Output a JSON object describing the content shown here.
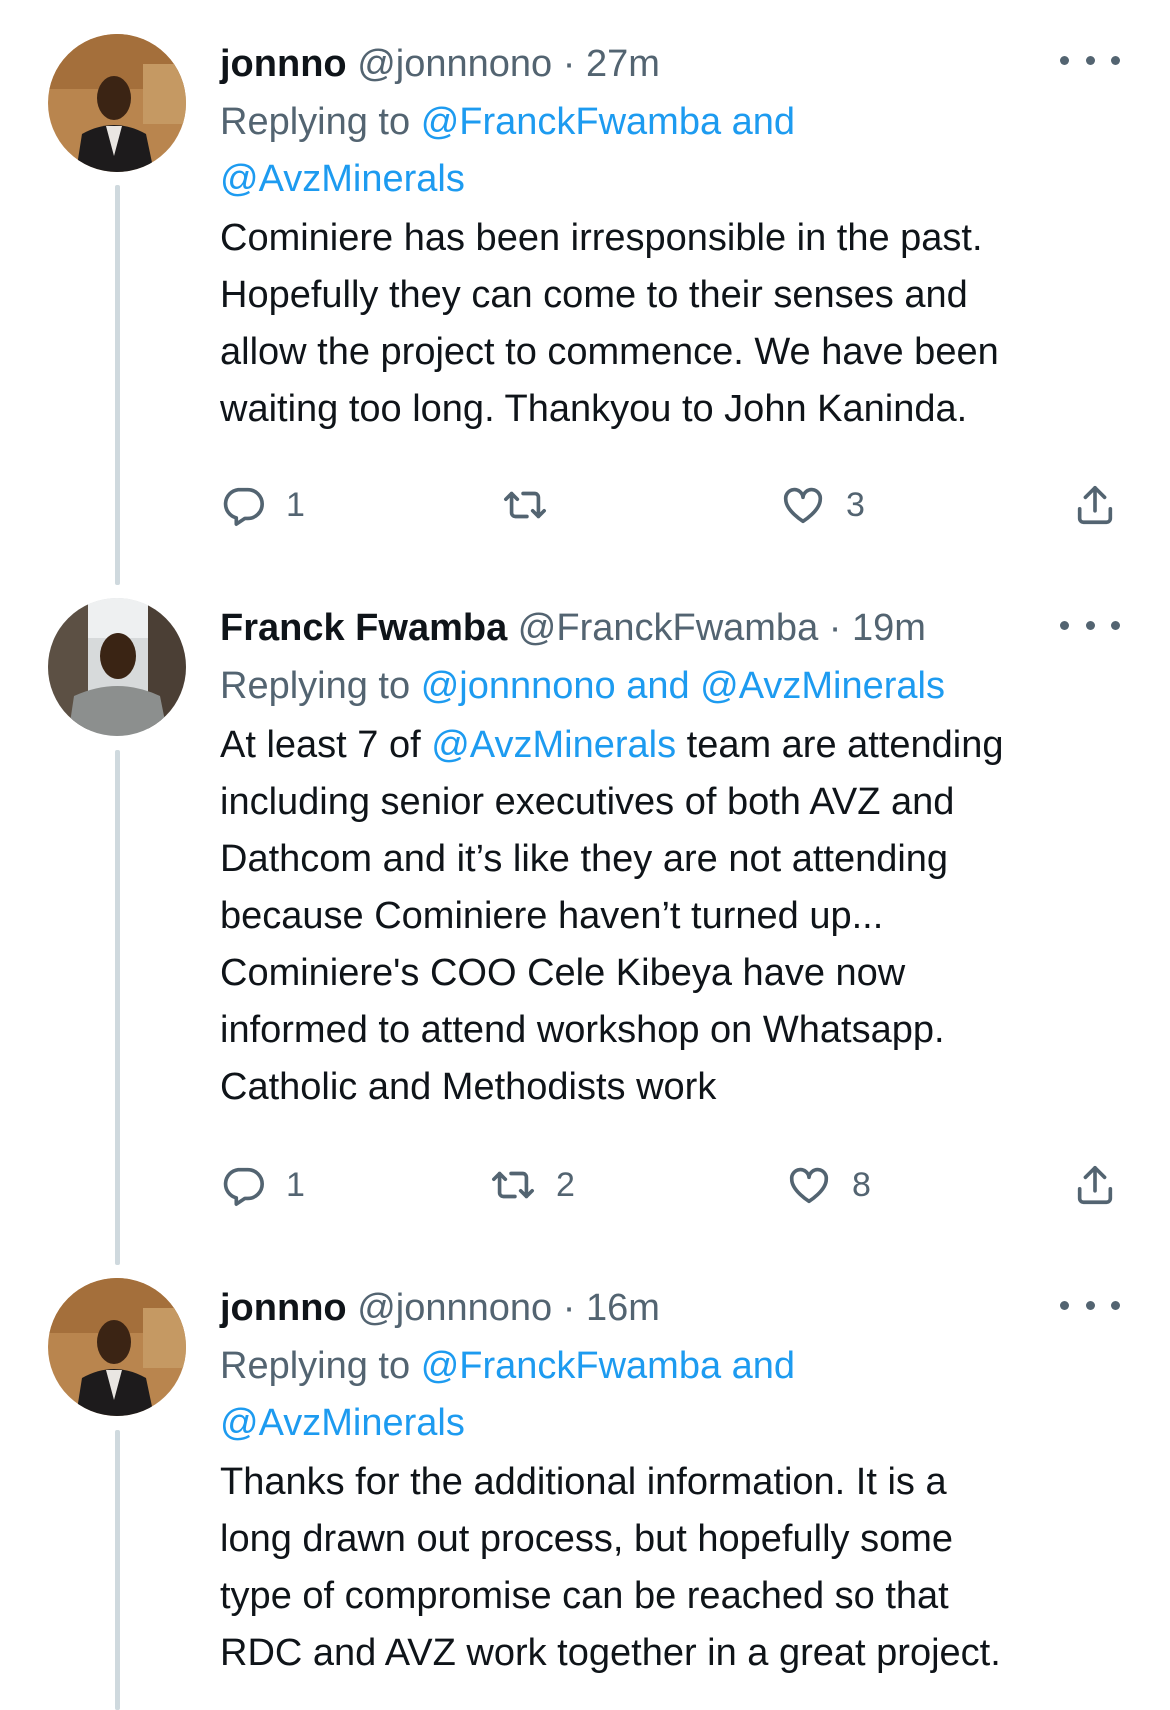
{
  "tweets": [
    {
      "name": "jonnno",
      "handle": "@jonnnono",
      "separator": "·",
      "time": "27m",
      "replying_prefix": "Replying to",
      "replying_line1": "@FranckFwamba and",
      "replying_line2": "@AvzMinerals",
      "body_lines": [
        "Cominiere has been irresponsible in the past.",
        "Hopefully they can come to their senses and",
        "allow the project to commence. We have been",
        "waiting too long. Thankyou to John Kaninda."
      ],
      "replies": "1",
      "retweets": "",
      "likes": "3"
    },
    {
      "name": "Franck Fwamba",
      "handle": "@FranckFwamba",
      "separator": "·",
      "time": "19m",
      "replying_prefix": "Replying to",
      "replying_line1": "@jonnnono and @AvzMinerals",
      "body_first_prefix": "At least 7 of ",
      "body_first_mention": "@AvzMinerals",
      "body_first_suffix": " team are attending",
      "body_lines": [
        "including senior executives of both AVZ and",
        "Dathcom and it’s like they are not attending",
        "because Cominiere haven’t turned up...",
        "Cominiere's COO Cele Kibeya have now",
        "informed to attend workshop on Whatsapp.",
        "Catholic and Methodists work"
      ],
      "replies": "1",
      "retweets": "2",
      "likes": "8"
    },
    {
      "name": "jonnno",
      "handle": "@jonnnono",
      "separator": "·",
      "time": "16m",
      "replying_prefix": "Replying to",
      "replying_line1": "@FranckFwamba and",
      "replying_line2": "@AvzMinerals",
      "body_lines": [
        "Thanks for the additional information. It is a",
        "long drawn out process, but hopefully some",
        "type of compromise can be reached so that",
        "RDC and AVZ work together in a great project."
      ]
    }
  ],
  "icons": {
    "reply": "reply-icon",
    "retweet": "retweet-icon",
    "like": "heart-icon",
    "share": "share-icon",
    "more": "more-icon"
  },
  "colors": {
    "link": "#1d9bf0",
    "secondary_text": "#536471",
    "thread_line": "#cfd9de"
  }
}
